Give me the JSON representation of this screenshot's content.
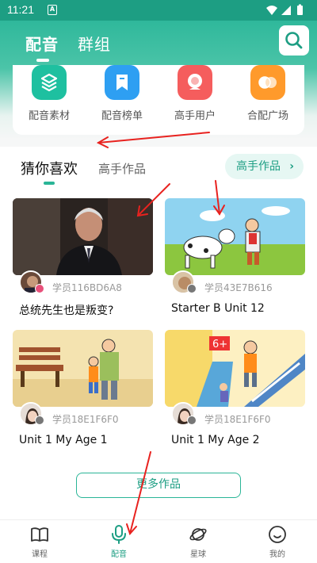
{
  "status_bar": {
    "time": "11:21",
    "notification_icon": "A"
  },
  "header": {
    "tabs": [
      "配音",
      "群组"
    ],
    "active_tab": "配音"
  },
  "categories": [
    {
      "label": "配音素材",
      "icon": "layers-icon",
      "color": "#1ec0a0"
    },
    {
      "label": "配音榜单",
      "icon": "bookmark-icon",
      "color": "#2e9ff2"
    },
    {
      "label": "高手用户",
      "icon": "user-avatar-icon",
      "color": "#f55d5d"
    },
    {
      "label": "合配广场",
      "icon": "duet-icon",
      "color": "#ff9a2b"
    }
  ],
  "recommend": {
    "tab_active": "猜你喜欢",
    "tab_other": "高手作品",
    "expert_button": "高手作品",
    "works": [
      {
        "user": "学员116BD6A8",
        "title": "总统先生也是叛变?"
      },
      {
        "user": "学员43E7B616",
        "title": "Starter B Unit 12"
      },
      {
        "user": "学员18E1F6F0",
        "title": "Unit 1 My Age 1"
      },
      {
        "user": "学员18E1F6F0",
        "title": "Unit 1 My Age 2"
      }
    ],
    "more_button": "更多作品"
  },
  "bottom_nav": [
    {
      "label": "课程",
      "icon": "book-icon"
    },
    {
      "label": "配音",
      "icon": "microphone-icon"
    },
    {
      "label": "星球",
      "icon": "planet-icon"
    },
    {
      "label": "我的",
      "icon": "smile-icon"
    }
  ],
  "active_nav": "配音",
  "colors": {
    "brand": "#1d9e83",
    "annotation": "#e8221f"
  }
}
